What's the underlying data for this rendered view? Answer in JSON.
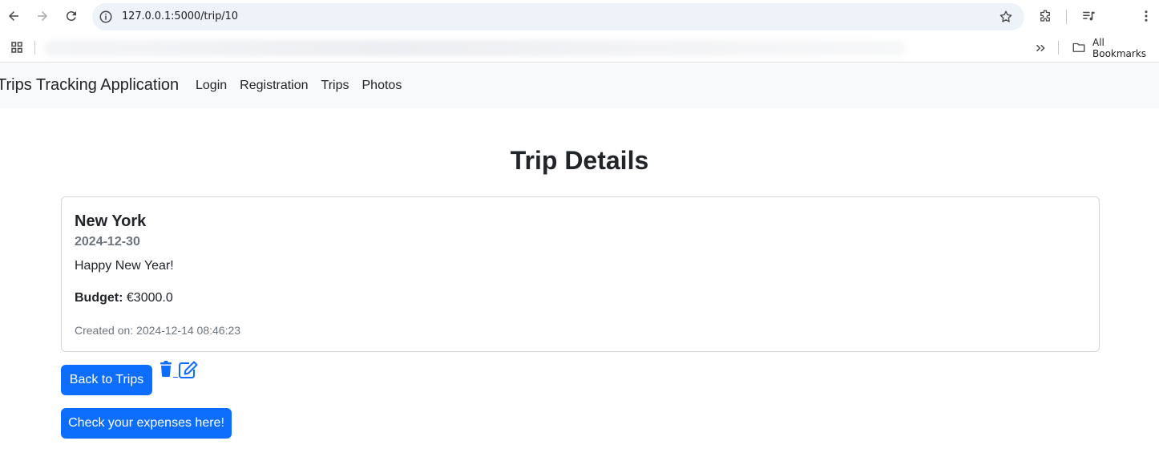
{
  "browser": {
    "url": "127.0.0.1:5000/trip/10",
    "bookmarks_all": "All Bookmarks"
  },
  "navbar": {
    "brand": "Trips Tracking Application",
    "links": [
      "Login",
      "Registration",
      "Trips",
      "Photos"
    ]
  },
  "page": {
    "title": "Trip Details"
  },
  "trip": {
    "destination": "New York",
    "date": "2024-12-30",
    "description": "Happy New Year!",
    "budget_label": "Budget:",
    "budget_value": "€3000.0",
    "created": "Created on: 2024-12-14 08:46:23"
  },
  "actions": {
    "back_label": "Back to Trips",
    "expenses_label": "Check your expenses here!"
  },
  "colors": {
    "primary": "#0d6efd",
    "navbar_bg": "#f8f9fa",
    "muted": "#6c757d"
  },
  "icons": {
    "delete": "trash-icon",
    "edit": "edit-icon"
  }
}
